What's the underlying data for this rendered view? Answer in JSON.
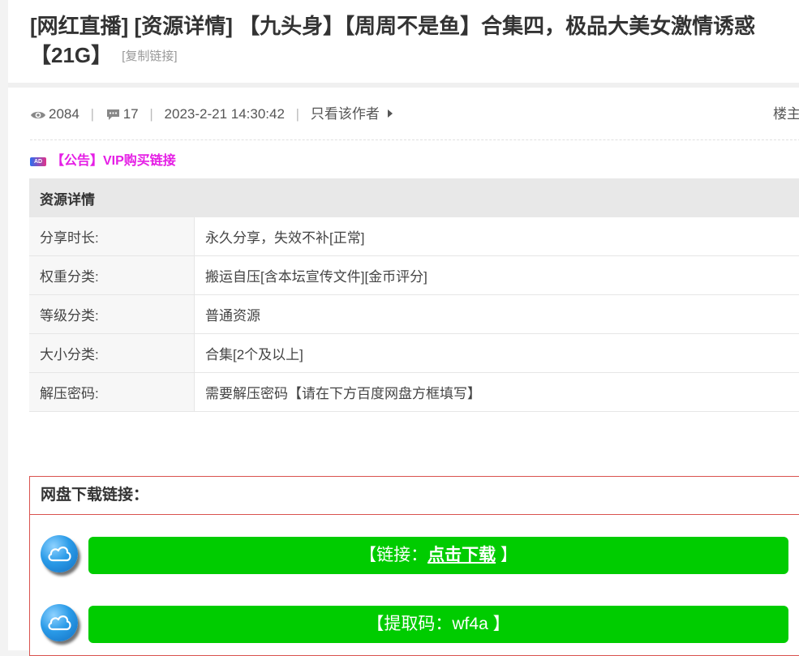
{
  "post": {
    "title": "[网红直播] [资源详情] 【九头身】【周周不是鱼】合集四，极品大美女激情诱惑【21G】",
    "copy_link": "[复制链接]"
  },
  "meta": {
    "views": "2084",
    "replies": "17",
    "datetime": "2023-2-21 14:30:42",
    "author_only": "只看该作者",
    "floor": "楼主"
  },
  "notice": {
    "badge": "AD",
    "text": "【公告】VIP购买链接"
  },
  "details": {
    "header": "资源详情",
    "rows": [
      {
        "label": "分享时长:",
        "value": "永久分享，失效不补[正常]"
      },
      {
        "label": "权重分类:",
        "value": "搬运自压[含本坛宣传文件][金币评分]"
      },
      {
        "label": "等级分类:",
        "value": "普通资源"
      },
      {
        "label": "大小分类:",
        "value": "合集[2个及以上]"
      },
      {
        "label": "解压密码:",
        "value": "需要解压密码【请在下方百度网盘方框填写】"
      }
    ]
  },
  "download": {
    "header": "网盘下载链接：",
    "link_prefix": "【链接：",
    "link_text": "点击下载",
    "link_suffix": "】",
    "code_text": "【提取码：wf4a 】"
  },
  "colors": {
    "notice": "#e51ee5",
    "button": "#00cc00",
    "download_border": "#d9534f"
  },
  "icons": [
    "eye-icon",
    "comment-icon",
    "triangle-right-icon",
    "cloud-icon"
  ]
}
